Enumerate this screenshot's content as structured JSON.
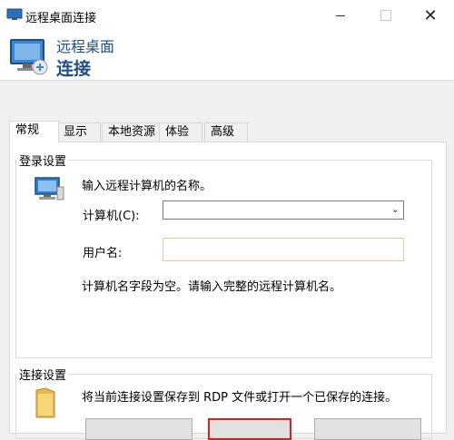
{
  "window": {
    "title": "远程桌面连接",
    "controls": {
      "minimize": "minimize",
      "maximize": "maximize",
      "close": "✕"
    }
  },
  "banner": {
    "line1": "远程桌面",
    "line2": "连接",
    "accent_color": "#1d4e89"
  },
  "tabs": [
    {
      "label": "常规",
      "active": true
    },
    {
      "label": "显示",
      "active": false
    },
    {
      "label": "本地资源",
      "active": false
    },
    {
      "label": "体验",
      "active": false
    },
    {
      "label": "高级",
      "active": false
    }
  ],
  "login": {
    "group_label": "登录设置",
    "intro": "输入远程计算机的名称。",
    "computer_label": "计算机(C):",
    "computer_value": "",
    "username_label": "用户名:",
    "username_value": "",
    "hint": "计算机名字段为空。请输入完整的远程计算机名。",
    "icon": "computer-icon"
  },
  "connection": {
    "group_label": "连接设置",
    "description": "将当前连接设置保存到 RDP 文件或打开一个已保存的连接。",
    "icon": "folder-icon",
    "highlight_color": "#e01e1e"
  }
}
